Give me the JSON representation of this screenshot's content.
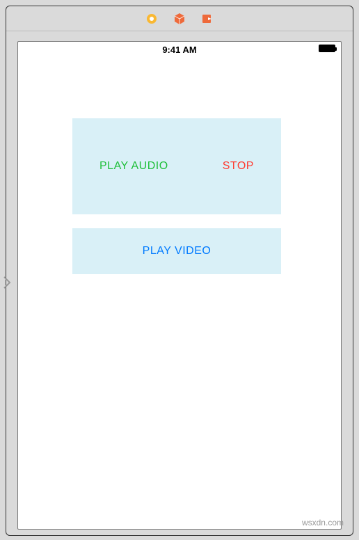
{
  "toolbar": {
    "icons": {
      "record": "record-icon",
      "cube": "cube-icon",
      "export": "export-icon"
    }
  },
  "status_bar": {
    "time": "9:41 AM"
  },
  "buttons": {
    "play_audio": "PLAY AUDIO",
    "stop": "STOP",
    "play_video": "PLAY VIDEO"
  },
  "watermark": "wsxdn.com",
  "colors": {
    "panel_bg": "#d9f0f7",
    "green": "#1fbf3a",
    "red": "#ff3b30",
    "blue": "#007aff",
    "toolbar_icon": "#f47c3c"
  }
}
